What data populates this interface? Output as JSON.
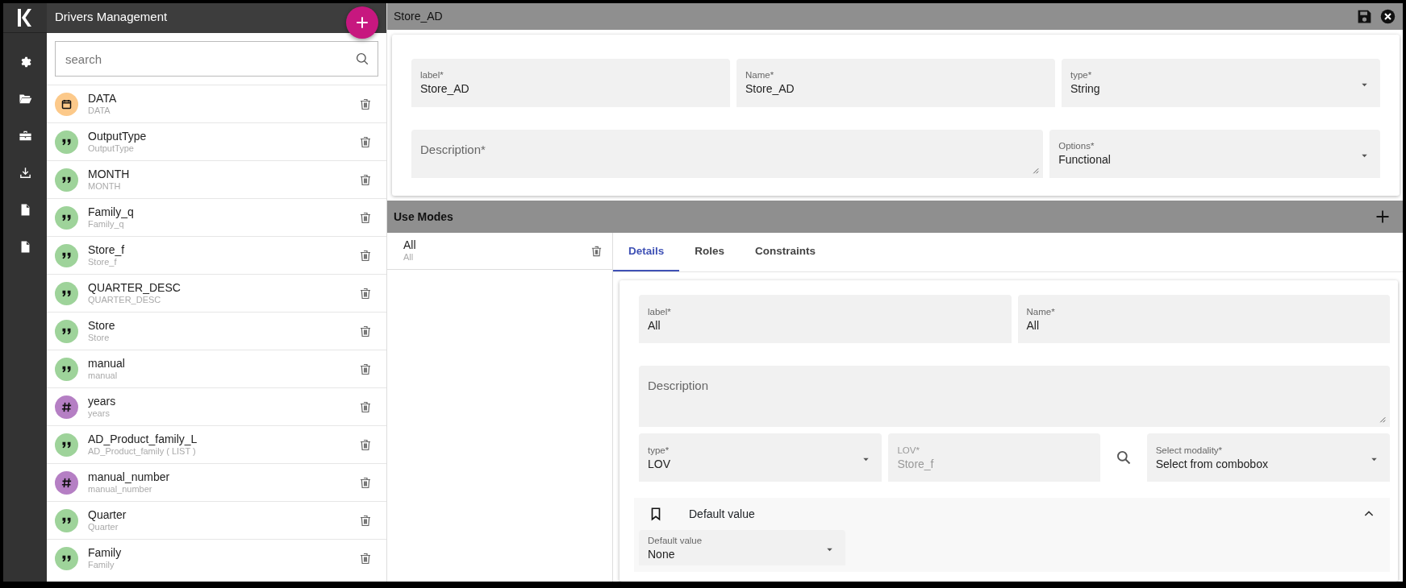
{
  "drivers_panel": {
    "title": "Drivers Management",
    "search": {
      "placeholder": "search"
    },
    "items": [
      {
        "label": "DATA",
        "name": "DATA",
        "kind": "date",
        "color": "#fcc98a"
      },
      {
        "label": "OutputType",
        "name": "OutputType",
        "kind": "string",
        "color": "#9ed39a"
      },
      {
        "label": "MONTH",
        "name": "MONTH",
        "kind": "string",
        "color": "#9ed39a"
      },
      {
        "label": "Family_q",
        "name": "Family_q",
        "kind": "string",
        "color": "#9ed39a"
      },
      {
        "label": "Store_f",
        "name": "Store_f",
        "kind": "string",
        "color": "#9ed39a"
      },
      {
        "label": "QUARTER_DESC",
        "name": "QUARTER_DESC",
        "kind": "string",
        "color": "#9ed39a"
      },
      {
        "label": "Store",
        "name": "Store",
        "kind": "string",
        "color": "#9ed39a"
      },
      {
        "label": "manual",
        "name": "manual",
        "kind": "string",
        "color": "#9ed39a"
      },
      {
        "label": "years",
        "name": "years",
        "kind": "number",
        "color": "#b57fc4"
      },
      {
        "label": "AD_Product_family_L",
        "name": "AD_Product_family ( LIST )",
        "kind": "string",
        "color": "#9ed39a"
      },
      {
        "label": "manual_number",
        "name": "manual_number",
        "kind": "number",
        "color": "#b57fc4"
      },
      {
        "label": "Quarter",
        "name": "Quarter",
        "kind": "string",
        "color": "#9ed39a"
      },
      {
        "label": "Family",
        "name": "Family",
        "kind": "string",
        "color": "#9ed39a"
      }
    ]
  },
  "editor": {
    "title": "Store_AD",
    "fields": [
      {
        "kind": "text",
        "label": "label*",
        "value": "Store_AD"
      },
      {
        "kind": "text",
        "label": "Name*",
        "value": "Store_AD"
      },
      {
        "kind": "select",
        "label": "type*",
        "value": "String"
      },
      {
        "kind": "textarea",
        "placeholder": "Description*"
      },
      {
        "kind": "select",
        "label": "Options*",
        "value": "Functional"
      }
    ],
    "use_modes": {
      "title": "Use Modes",
      "items": [
        {
          "label": "All",
          "name": "All"
        }
      ],
      "tabs": [
        {
          "label": "Details",
          "selected": true
        },
        {
          "label": "Roles",
          "selected": false
        },
        {
          "label": "Constraints",
          "selected": false
        }
      ],
      "details": {
        "fields": [
          {
            "kind": "text",
            "label": "label*",
            "value": "All"
          },
          {
            "kind": "text",
            "label": "Name*",
            "value": "All"
          },
          {
            "kind": "textarea",
            "placeholder": "Description"
          },
          {
            "kind": "select",
            "label": "type*",
            "value": "LOV"
          },
          {
            "kind": "text",
            "label": "LOV*",
            "value": "Store_f",
            "disabled": true
          },
          {
            "kind": "search"
          },
          {
            "kind": "select",
            "label": "Select modality*",
            "value": "Select from combobox"
          }
        ],
        "default_value": {
          "title": "Default value",
          "expanded": true,
          "field": {
            "kind": "select",
            "label": "Default value",
            "value": "None"
          }
        }
      }
    }
  }
}
